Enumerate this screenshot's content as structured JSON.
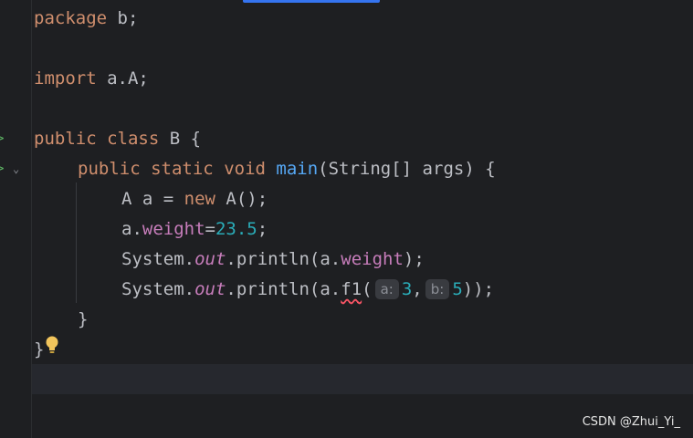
{
  "editor": {
    "lines": {
      "l1": {
        "kw": "package",
        "rest": " b;"
      },
      "l3": {
        "kw": "import",
        "rest": " a.A;"
      },
      "l5": {
        "kw1": "public",
        "kw2": "class",
        "name": " B {"
      },
      "l6": {
        "kw1": "public",
        "kw2": "static",
        "kw3": "void",
        "fn": "main",
        "params": "(String[] args) {"
      },
      "l7": {
        "pre": "A a = ",
        "kw": "new",
        "post": " A();"
      },
      "l8": {
        "obj": "a.",
        "field": "weight",
        "eq": "=",
        "num": "23.5",
        "semi": ";"
      },
      "l9": {
        "sys": "System.",
        "out": "out",
        "mid": ".println(a.",
        "field": "weight",
        "end": ");"
      },
      "l10": {
        "sys": "System.",
        "out": "out",
        "mid": ".println(a.",
        "call": "f1",
        "paren": "(",
        "hint_a": "a:",
        "num_a": "3",
        "comma": ",",
        "hint_b": "b:",
        "num_b": "5",
        "end": "));"
      },
      "l11": {
        "brace": "}"
      },
      "l12": {
        "brace": "}"
      }
    },
    "colors": {
      "background": "#1e1f22",
      "keyword": "#cf8e6d",
      "method": "#56a8f5",
      "field": "#c77dbb",
      "number": "#2aacb8",
      "text": "#bcbec4",
      "accent": "#3574f0"
    },
    "icons": {
      "run": "run-gutter-icon",
      "fold": "fold-chevron-icon",
      "intention": "lightbulb-icon"
    }
  },
  "watermark": "CSDN @Zhui_Yi_"
}
